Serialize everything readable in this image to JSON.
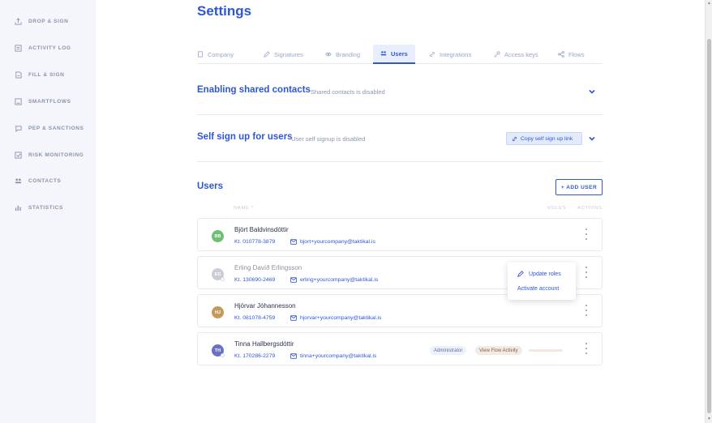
{
  "sidebar": {
    "items": [
      {
        "label": "DROP & SIGN",
        "icon": "upload-icon"
      },
      {
        "label": "ACTIVITY LOG",
        "icon": "log-icon"
      },
      {
        "label": "FILL & SIGN",
        "icon": "form-icon"
      },
      {
        "label": "SMARTFLOWS",
        "icon": "flow-icon"
      },
      {
        "label": "PEP & SANCTIONS",
        "icon": "flag-icon"
      },
      {
        "label": "RISK MONITORING",
        "icon": "monitor-icon"
      },
      {
        "label": "CONTACTS",
        "icon": "people-icon"
      },
      {
        "label": "STATISTICS",
        "icon": "chart-icon"
      }
    ]
  },
  "page": {
    "title": "Settings"
  },
  "tabs": [
    {
      "label": "Company"
    },
    {
      "label": "Signatures"
    },
    {
      "label": "Branding"
    },
    {
      "label": "Users",
      "active": true
    },
    {
      "label": "Integrations"
    },
    {
      "label": "Access keys"
    },
    {
      "label": "Flows"
    }
  ],
  "shared_contacts": {
    "title": "Enabling shared contacts",
    "status": "Shared contacts is disabled"
  },
  "self_signup": {
    "title": "Self sign up for users",
    "status": "User self signup is disabled",
    "copy_label": "Copy self sign up link"
  },
  "users_section": {
    "title": "Users",
    "add_label": "+ ADD USER",
    "col_name": "NAME ^",
    "col_roles": "ROLES",
    "col_actions": "ACTIONS"
  },
  "users": [
    {
      "initials": "BB",
      "name": "Björt Baldvinsdóttir",
      "kt": "Kt. 010778-3879",
      "email": "bjort+yourcompany@taktikal.is",
      "avatar_color": "#6fbf73"
    },
    {
      "initials": "ED",
      "name": "Erling Davíð Erlingsson",
      "kt": "Kt. 130690-2469",
      "email": "erling+yourcompany@taktikal.is",
      "avatar_color": "#c9cdd8"
    },
    {
      "initials": "HJ",
      "name": "Hjörvar Jóhannesson",
      "kt": "Kt. 081078-4759",
      "email": "hjorvar+yourcompany@taktikal.is",
      "avatar_color": "#c49a5a"
    },
    {
      "initials": "TH",
      "name": "Tinna Hallbergsdóttir",
      "kt": "Kt. 170286-2279",
      "email": "tinna+yourcompany@taktikal.is",
      "avatar_color": "#6a71c4",
      "roles": [
        "Administrator",
        "View Flow Activity"
      ]
    }
  ],
  "popup_menu": {
    "update_roles": "Update roles",
    "activate_account": "Activate account"
  },
  "colors": {
    "accent": "#2f56d3",
    "sidebar_bg": "#f4f6fb"
  }
}
